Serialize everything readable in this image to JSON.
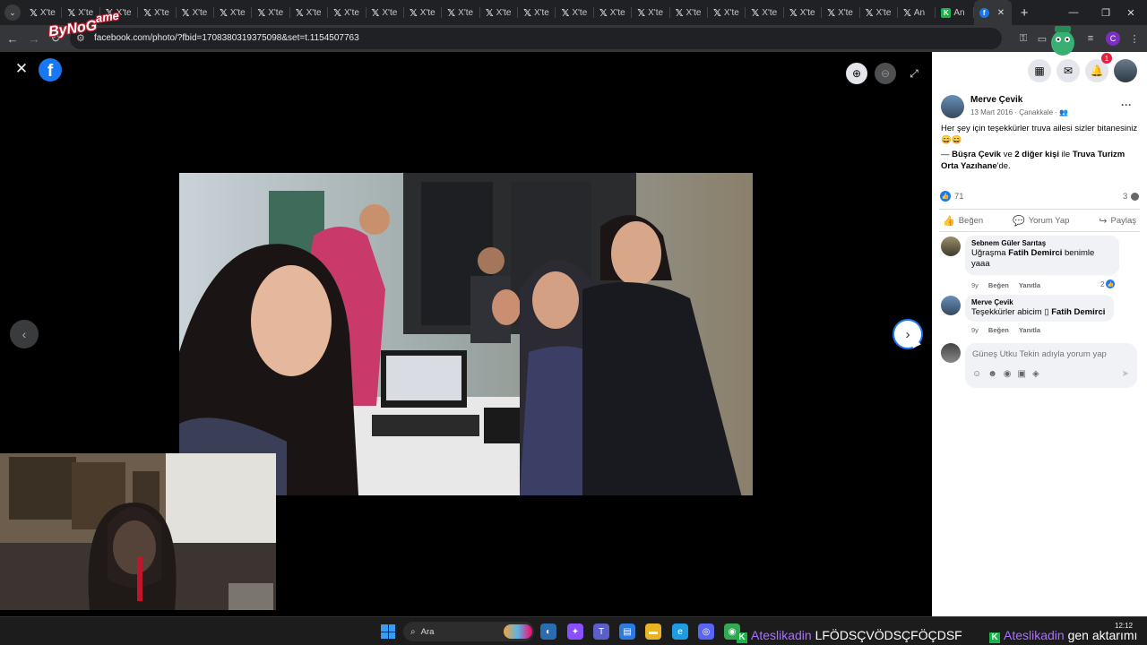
{
  "browser": {
    "tabs": [
      {
        "label": "X'te",
        "icon": "x-logo"
      },
      {
        "label": "X'te",
        "icon": "x-logo"
      },
      {
        "label": "X'te",
        "icon": "x-logo"
      },
      {
        "label": "X'te",
        "icon": "x-logo"
      },
      {
        "label": "X'te",
        "icon": "x-logo"
      },
      {
        "label": "X'te",
        "icon": "x-logo"
      },
      {
        "label": "X'te",
        "icon": "x-logo"
      },
      {
        "label": "X'te",
        "icon": "x-logo"
      },
      {
        "label": "X'te",
        "icon": "x-logo"
      },
      {
        "label": "X'te",
        "icon": "x-logo"
      },
      {
        "label": "X'te",
        "icon": "x-logo"
      },
      {
        "label": "X'te",
        "icon": "x-logo"
      },
      {
        "label": "X'te",
        "icon": "x-logo"
      },
      {
        "label": "X'te",
        "icon": "x-logo"
      },
      {
        "label": "X'te",
        "icon": "x-logo"
      },
      {
        "label": "X'te",
        "icon": "x-logo"
      },
      {
        "label": "X'te",
        "icon": "x-logo"
      },
      {
        "label": "X'te",
        "icon": "x-logo"
      },
      {
        "label": "X'te",
        "icon": "x-logo"
      },
      {
        "label": "X'te",
        "icon": "x-logo"
      },
      {
        "label": "X'te",
        "icon": "x-logo"
      },
      {
        "label": "X'te",
        "icon": "x-logo"
      },
      {
        "label": "X'te",
        "icon": "x-logo"
      },
      {
        "label": "An",
        "icon": "x-logo"
      },
      {
        "label": "An",
        "icon": "kick-logo"
      }
    ],
    "active_tab_icon": "facebook-logo",
    "url": "facebook.com/photo/?fbid=1708380319375098&set=t.1154507763",
    "profile_initial": "C"
  },
  "overlay": {
    "logo_text": "ByNoG",
    "logo_suffix": "ame"
  },
  "viewer": {
    "close_icon": "close-icon",
    "zoom_in_icon": "zoom-in-icon",
    "zoom_out_icon": "zoom-out-icon",
    "fullscreen_icon": "fullscreen-icon",
    "prev_icon": "chevron-left-icon",
    "next_icon": "chevron-right-icon"
  },
  "post": {
    "author": "Merve Çevik",
    "date": "13 Mart 2016",
    "location": "Çanakkale",
    "caption": "Her şey için teşekkürler truva ailesi sizler bitanesiniz 😄😄",
    "tag_prefix": "— ",
    "tag_person": "Büşra Çevik",
    "tag_and": " ve ",
    "tag_others": "2 diğer kişi",
    "tag_with": " ile ",
    "tag_place": "Truva Turizm Orta Yazıhane",
    "tag_suffix": "'de.",
    "likes": "71",
    "comments_count": "3",
    "actions": {
      "like": "Beğen",
      "comment": "Yorum Yap",
      "share": "Paylaş"
    },
    "notifications_count": "1"
  },
  "comments": [
    {
      "author": "Sebnem Güler Sarıtaş",
      "text_before": "Uğraşma ",
      "mention": "Fatih Demirci",
      "text_after": " benimle yaaa",
      "age": "9y",
      "like": "Beğen",
      "reply": "Yanıtla",
      "reactions": "2"
    },
    {
      "author": "Merve Çevik",
      "text_before": "Teşekkürler abicim ",
      "glyph": "▯",
      "mention": "Fatih Demirci",
      "age": "9y",
      "like": "Beğen",
      "reply": "Yanıtla"
    }
  ],
  "composer": {
    "placeholder": "Güneş Utku Tekin adıyla yorum yap"
  },
  "taskbar": {
    "search_label": "Ara",
    "ticker_user": "Ateslikadin",
    "ticker_message": " LFÖDSÇVÖDSÇFÖÇDSF",
    "ticker2_user": "Ateslikadin",
    "ticker2_message": " gen aktarımı",
    "time": "12:12"
  },
  "colors": {
    "facebook_blue": "#1877f2",
    "kick_green": "#19b34a",
    "notification_red": "#e41e3f",
    "chat_user_purple": "#a970ff"
  }
}
